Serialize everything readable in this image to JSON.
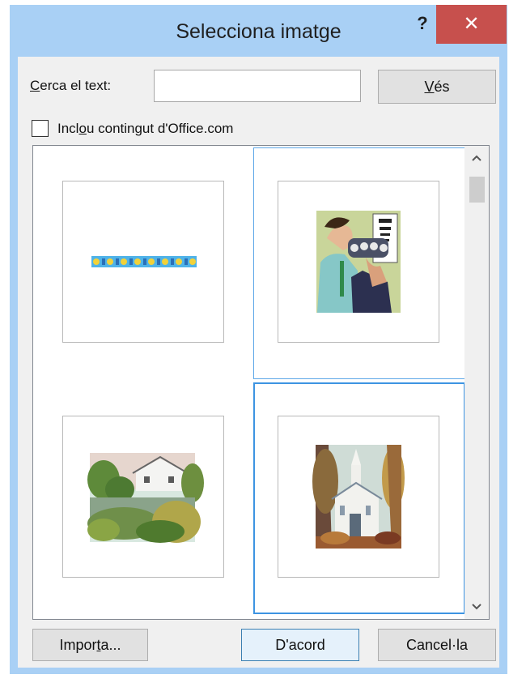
{
  "window": {
    "title": "Selecciona imatge",
    "help_label": "?",
    "close_label": "✕"
  },
  "search": {
    "label_prefix": "",
    "label_access": "C",
    "label_rest": "erca el text:",
    "value": "",
    "placeholder": ""
  },
  "go_button": {
    "access": "V",
    "rest": "és"
  },
  "include_office": {
    "pre": "Incl",
    "access": "o",
    "post": "u contingut d'Office.com",
    "checked": false
  },
  "images": [
    {
      "name": "dotted-border-clipart",
      "state": "normal"
    },
    {
      "name": "eye-exam-clipart",
      "state": "hover"
    },
    {
      "name": "house-by-lake-clipart",
      "state": "normal"
    },
    {
      "name": "white-church-clipart",
      "state": "selected"
    }
  ],
  "footer": {
    "import_pre": "Impor",
    "import_access": "t",
    "import_post": "a...",
    "ok_label": "D'acord",
    "cancel_label": "Cancel·la"
  },
  "colors": {
    "title_bar": "#a9d0f5",
    "close": "#c7504d",
    "selection": "#3d94e2"
  }
}
